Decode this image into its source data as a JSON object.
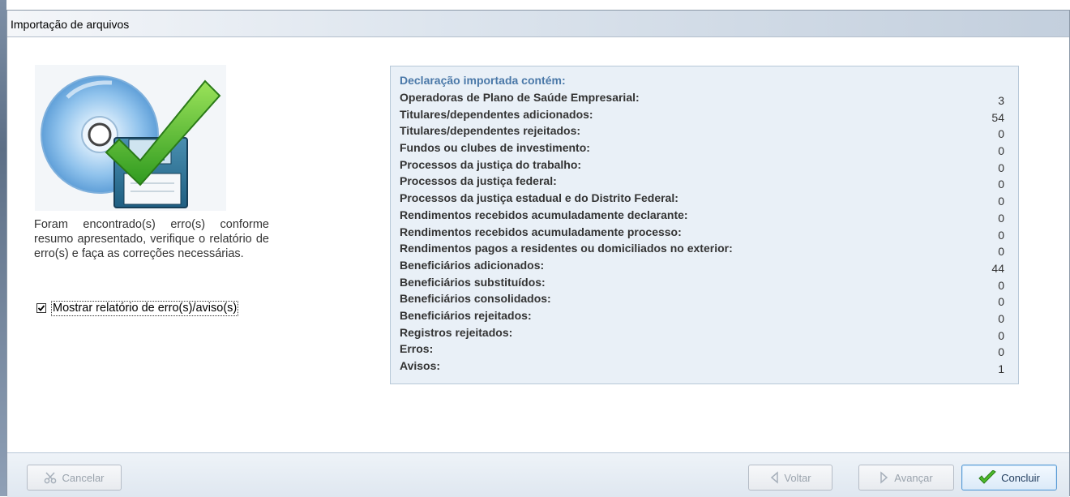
{
  "window": {
    "title": "Importação de arquivos"
  },
  "illustration": {
    "icon": "disk-floppy-check-icon"
  },
  "message": "Foram encontrado(s) erro(s) conforme resumo apresentado, verifique o relatório de erro(s) e faça as correções necessárias.",
  "checkbox": {
    "label": "Mostrar relatório de erro(s)/aviso(s)",
    "checked": true
  },
  "summary": {
    "header": "Declaração importada contém:",
    "rows": [
      {
        "label": "Operadoras de Plano de Saúde Empresarial:",
        "value": "3"
      },
      {
        "label": "Titulares/dependentes adicionados:",
        "value": "54"
      },
      {
        "label": "Titulares/dependentes rejeitados:",
        "value": "0"
      },
      {
        "label": "Fundos ou clubes de investimento:",
        "value": "0"
      },
      {
        "label": "Processos da justiça do trabalho:",
        "value": "0"
      },
      {
        "label": "Processos da justiça federal:",
        "value": "0"
      },
      {
        "label": "Processos da justiça estadual e do Distrito Federal:",
        "value": "0"
      },
      {
        "label": "Rendimentos recebidos acumuladamente declarante:",
        "value": "0"
      },
      {
        "label": "Rendimentos recebidos acumuladamente processo:",
        "value": "0"
      },
      {
        "label": "Rendimentos pagos a residentes ou domiciliados no exterior:",
        "value": "0"
      },
      {
        "label": "Beneficiários adicionados:",
        "value": "44"
      },
      {
        "label": "Beneficiários substituídos:",
        "value": "0"
      },
      {
        "label": "Beneficiários consolidados:",
        "value": "0"
      },
      {
        "label": "Beneficiários rejeitados:",
        "value": "0"
      },
      {
        "label": "Registros rejeitados:",
        "value": "0"
      },
      {
        "label": "Erros:",
        "value": "0"
      },
      {
        "label": "Avisos:",
        "value": "1"
      }
    ]
  },
  "footer": {
    "cancel_label": "Cancelar",
    "back_label": "Voltar",
    "next_label": "Avançar",
    "finish_label": "Concluir"
  },
  "colors": {
    "accent": "#4a78a8",
    "panel": "#e9f0f7",
    "check": "#4cbb2a"
  }
}
